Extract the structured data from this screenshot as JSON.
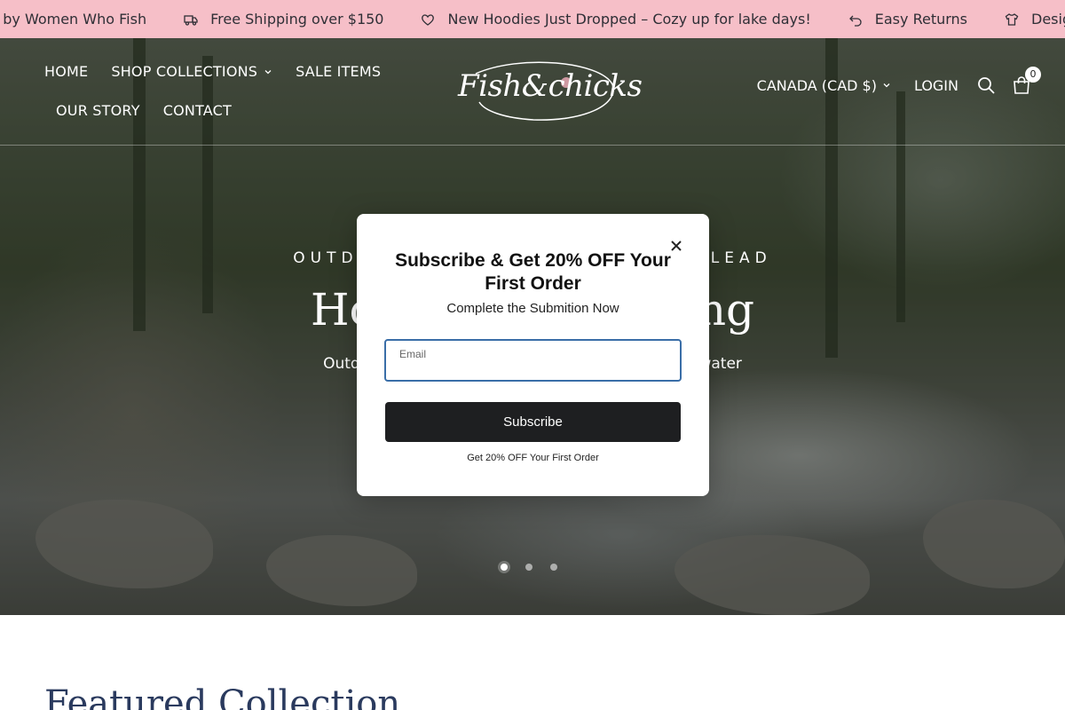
{
  "announcement": {
    "items": [
      {
        "text": "d by Women Who Fish",
        "icon": "none"
      },
      {
        "text": "Free Shipping over $150",
        "icon": "truck-icon"
      },
      {
        "text": "New Hoodies Just Dropped – Cozy up for lake days!",
        "icon": "heart-icon"
      },
      {
        "text": "Easy Returns",
        "icon": "return-arrow-icon"
      },
      {
        "text": "Design",
        "icon": "shirt-icon"
      }
    ],
    "background": "#f6bfc8"
  },
  "header": {
    "nav": {
      "home": "HOME",
      "shop_collections": "SHOP COLLECTIONS",
      "sale_items": "SALE ITEMS",
      "our_story": "OUR STORY",
      "contact": "CONTACT"
    },
    "logo_text": "Fish&chicks",
    "currency": "CANADA (CAD $)",
    "login": "LOGIN",
    "cart_count": "0"
  },
  "hero": {
    "eyebrow": "OUTDOOR GEAR FOR WOMEN WHO LEAD",
    "title": "Hoodies for Fishing",
    "subtitle": "Outdoor apparel made for comfort on and off the water",
    "slides_total": 3,
    "active_slide": 1
  },
  "modal": {
    "title": "Subscribe & Get 20% OFF Your First Order",
    "subtitle": "Complete the Submition Now",
    "email_label": "Email",
    "email_value": "",
    "subscribe_label": "Subscribe",
    "note": "Get 20% OFF Your First Order"
  },
  "featured": {
    "title": "Featured Collection"
  },
  "colors": {
    "announce_bg": "#f6bfc8",
    "button_dark": "#1e1f21",
    "input_border": "#3a6ea8",
    "heading_navy": "#2a3a5e"
  }
}
